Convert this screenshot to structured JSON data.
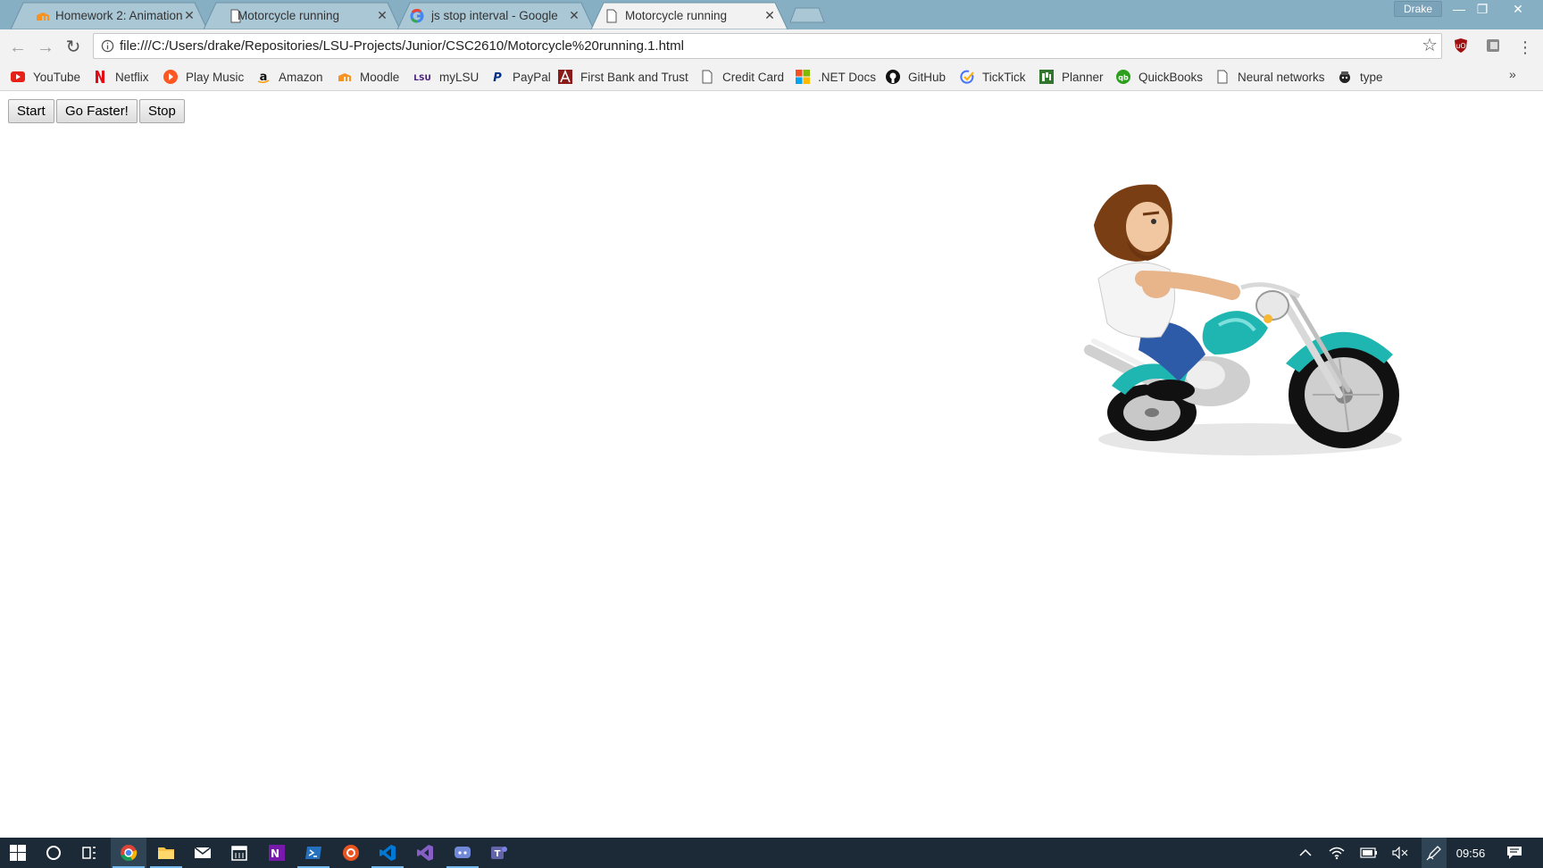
{
  "window": {
    "profile_name": "Drake",
    "minimize_symbol": "—",
    "restore_symbol": "❐",
    "close_symbol": "✕"
  },
  "tabs": [
    {
      "title": "Homework 2: Animation",
      "favicon": "moodle-icon",
      "active": false
    },
    {
      "title": "Motorcycle running",
      "favicon": "document-icon",
      "active": false
    },
    {
      "title": "js stop interval - Google",
      "favicon": "google-icon",
      "active": false
    },
    {
      "title": "Motorcycle running",
      "favicon": "document-icon",
      "active": true
    }
  ],
  "tab_close_symbol": "✕",
  "toolbar": {
    "back_symbol": "←",
    "forward_symbol": "→",
    "reload_symbol": "↻",
    "url": "file:///C:/Users/drake/Repositories/LSU-Projects/Junior/CSC2610/Motorcycle%20running.1.html",
    "star_symbol": "☆",
    "menu_symbol": "⋮"
  },
  "bookmarks": [
    {
      "label": "YouTube",
      "icon": "youtube-icon"
    },
    {
      "label": "Netflix",
      "icon": "netflix-icon"
    },
    {
      "label": "Play Music",
      "icon": "play-music-icon"
    },
    {
      "label": "Amazon",
      "icon": "amazon-icon"
    },
    {
      "label": "Moodle",
      "icon": "moodle-icon"
    },
    {
      "label": "myLSU",
      "icon": "lsu-icon"
    },
    {
      "label": "PayPal",
      "icon": "paypal-icon"
    },
    {
      "label": "First Bank and Trust",
      "icon": "bank-icon"
    },
    {
      "label": "Credit Card",
      "icon": "document-icon"
    },
    {
      "label": ".NET Docs",
      "icon": "microsoft-icon"
    },
    {
      "label": "GitHub",
      "icon": "github-icon"
    },
    {
      "label": "TickTick",
      "icon": "ticktick-icon"
    },
    {
      "label": "Planner",
      "icon": "planner-icon"
    },
    {
      "label": "QuickBooks",
      "icon": "quickbooks-icon"
    },
    {
      "label": "Neural networks",
      "icon": "document-icon"
    },
    {
      "label": "type",
      "icon": "type-icon"
    }
  ],
  "bookmarks_overflow": "»",
  "page": {
    "buttons": {
      "start": "Start",
      "faster": "Go Faster!",
      "stop": "Stop"
    }
  },
  "taskbar": {
    "clock": "09:56",
    "apps": [
      "start-icon",
      "cortana-icon",
      "task-view-icon",
      "chrome-icon",
      "file-explorer-icon",
      "mail-icon",
      "calendar-icon",
      "onenote-icon",
      "powershell-icon",
      "ubuntu-icon",
      "vscode-icon",
      "visual-studio-icon",
      "discord-icon",
      "teams-icon"
    ]
  },
  "colors": {
    "tabstrip": "#87afc4",
    "toolbar": "#f2f2f2",
    "taskbar": "#1b2a36",
    "motorcycle_teal": "#1fb6b1"
  }
}
